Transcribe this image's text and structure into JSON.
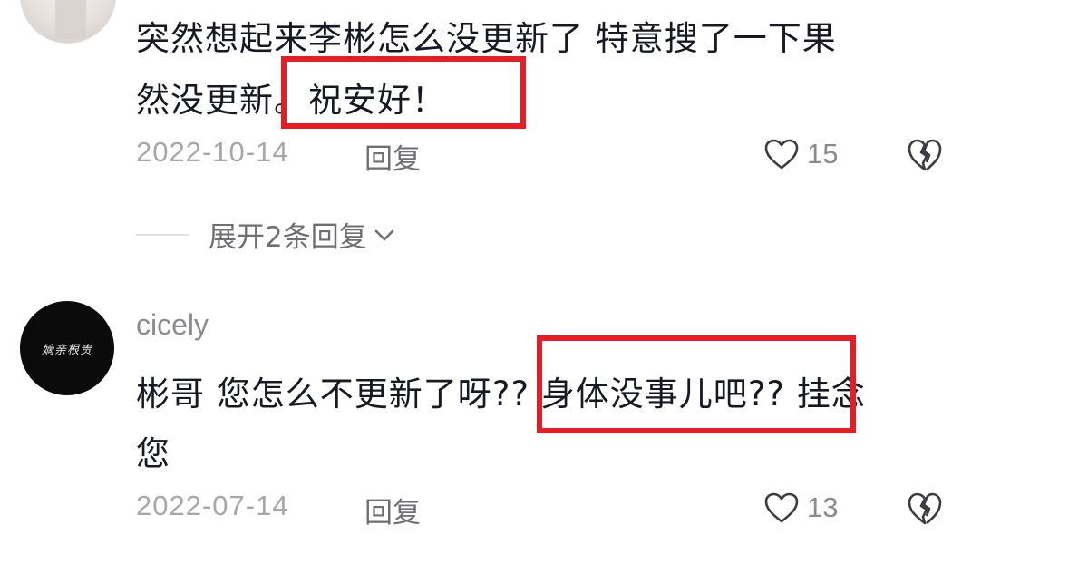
{
  "comments": [
    {
      "lines": [
        "突然想起来李彬怎么没更新了 特意搜了一下果",
        "然没更新。祝安好！"
      ],
      "date": "2022-10-14",
      "reply_label": "回复",
      "likes": "15",
      "replies_toggle": "展开2条回复"
    },
    {
      "username": "cicely",
      "avatar_text": "嫡亲根贵",
      "lines": [
        "彬哥 您怎么不更新了呀?? 身体没事儿吧?? 挂念",
        "您"
      ],
      "date": "2022-07-14",
      "reply_label": "回复",
      "likes": "13"
    }
  ],
  "colors": {
    "highlight": "#e51e25",
    "text": "#161823",
    "muted": "#a7a7ab"
  },
  "icons": [
    "heart-icon",
    "broken-heart-icon",
    "chevron-down-icon"
  ]
}
